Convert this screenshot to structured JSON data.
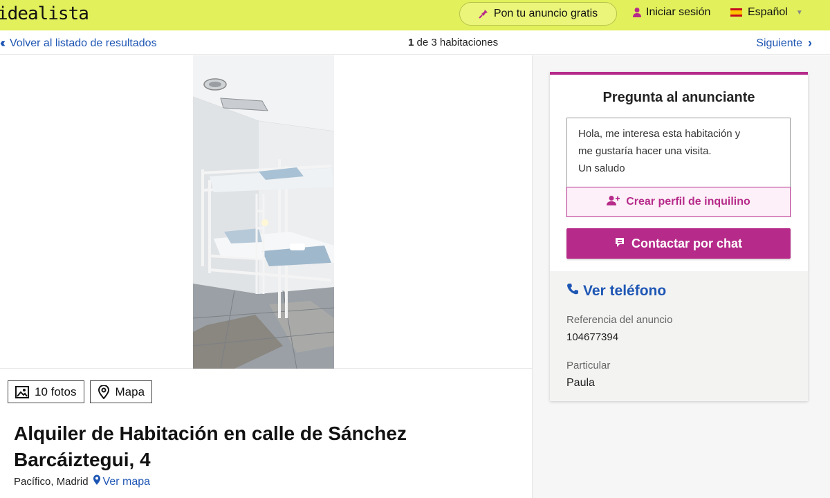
{
  "header": {
    "logo": "idealista",
    "publish_label": "Pon tu anuncio gratis",
    "login_label": "Iniciar sesión",
    "language_label": "Español",
    "colors": {
      "bar": "#e1f05b",
      "accent": "#b62b8a",
      "link": "#1e56b4"
    }
  },
  "subnav": {
    "back_label": "Volver al listado de resultados",
    "counter_current": "1",
    "counter_rest": "de 3 habitaciones",
    "next_label": "Siguiente"
  },
  "gallery": {
    "photos_label": "10 fotos",
    "map_label": "Mapa"
  },
  "listing": {
    "title": "Alquiler de Habitación en calle de Sánchez Barcáiztegui, 4",
    "location": "Pacífico, Madrid",
    "map_link": "Ver mapa"
  },
  "contact": {
    "title": "Pregunta al anunciante",
    "message_lines": [
      "Hola, me interesa esta habitación y",
      "me gustaría hacer una visita.",
      "Un saludo"
    ],
    "profile_button": "Crear perfil de inquilino",
    "chat_button": "Contactar por chat",
    "phone_link": "Ver teléfono",
    "reference_label": "Referencia del anuncio",
    "reference_value": "104677394",
    "advertiser_type": "Particular",
    "advertiser_name": "Paula"
  }
}
